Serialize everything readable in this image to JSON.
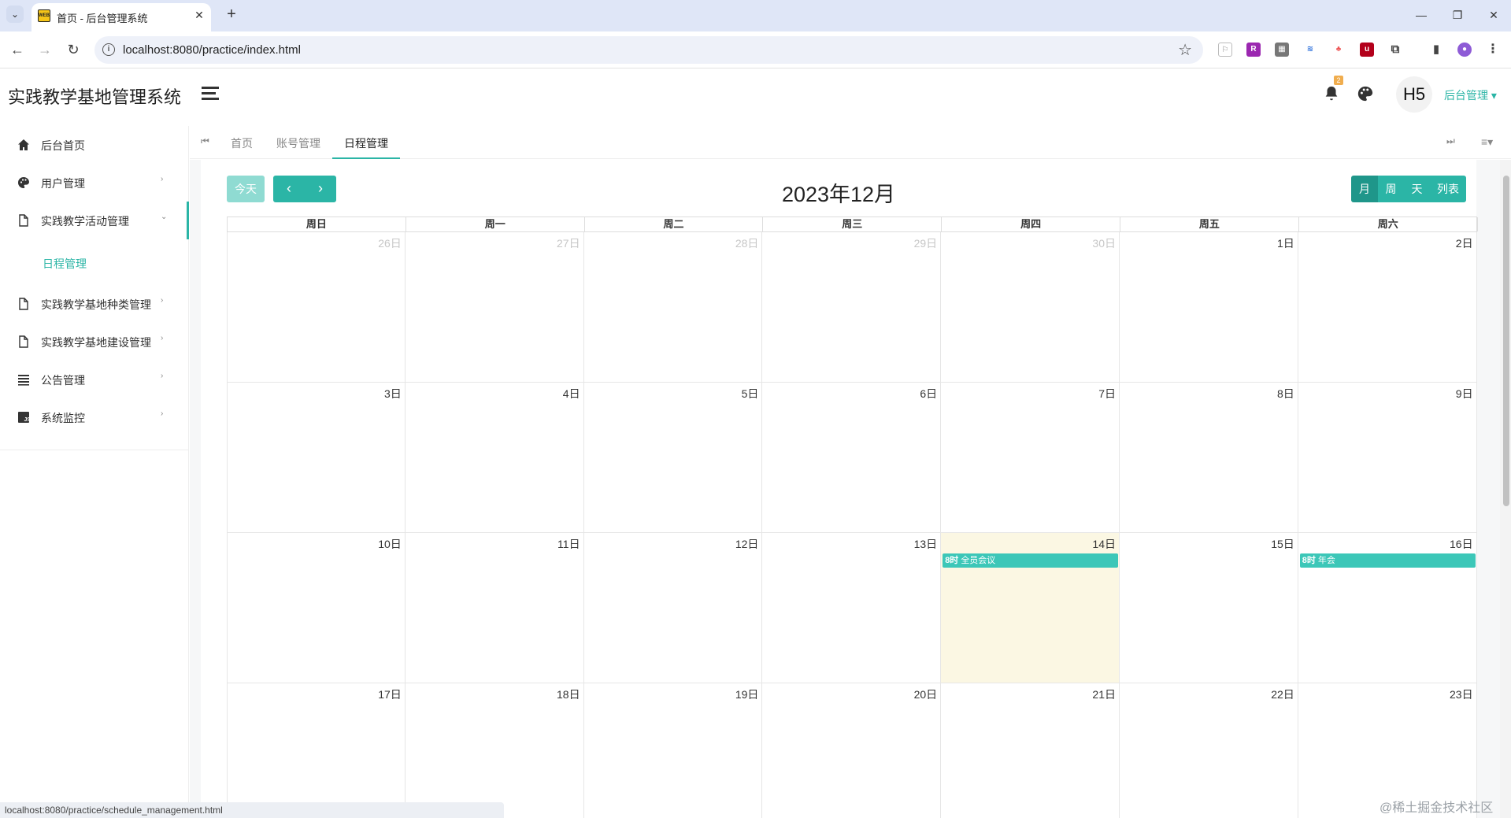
{
  "browser": {
    "tab_title": "首页 - 后台管理系统",
    "url": "localhost:8080/practice/index.html",
    "status_url": "localhost:8080/practice/schedule_management.html"
  },
  "app": {
    "brand": "实践教学基地管理系统",
    "avatar_text": "H5",
    "user_menu": "后台管理 ▾",
    "notification_count": "2"
  },
  "sidebar": {
    "items": [
      {
        "label": "后台首页",
        "icon": "home-icon"
      },
      {
        "label": "用户管理",
        "icon": "palette-icon"
      },
      {
        "label": "实践教学活动管理",
        "icon": "file-icon"
      },
      {
        "label": "日程管理"
      },
      {
        "label": "实践教学基地种类管理",
        "icon": "file-icon"
      },
      {
        "label": "实践教学基地建设管理",
        "icon": "file-icon"
      },
      {
        "label": "公告管理",
        "icon": "list-icon"
      },
      {
        "label": "系统监控",
        "icon": "js-icon"
      }
    ]
  },
  "tabs": [
    "首页",
    "账号管理",
    "日程管理"
  ],
  "calendar": {
    "today_label": "今天",
    "title": "2023年12月",
    "views": [
      "月",
      "周",
      "天",
      "列表"
    ],
    "weekdays": [
      "周日",
      "周一",
      "周二",
      "周三",
      "周四",
      "周五",
      "周六"
    ],
    "weeks": [
      [
        "26日",
        "27日",
        "28日",
        "29日",
        "30日",
        "1日",
        "2日"
      ],
      [
        "3日",
        "4日",
        "5日",
        "6日",
        "7日",
        "8日",
        "9日"
      ],
      [
        "10日",
        "11日",
        "12日",
        "13日",
        "14日",
        "15日",
        "16日"
      ],
      [
        "17日",
        "18日",
        "19日",
        "20日",
        "21日",
        "22日",
        "23日"
      ]
    ],
    "events": [
      {
        "time": "8时",
        "title": "全员会议"
      },
      {
        "time": "8时",
        "title": "年会"
      }
    ]
  },
  "watermark": "@稀土掘金技术社区"
}
